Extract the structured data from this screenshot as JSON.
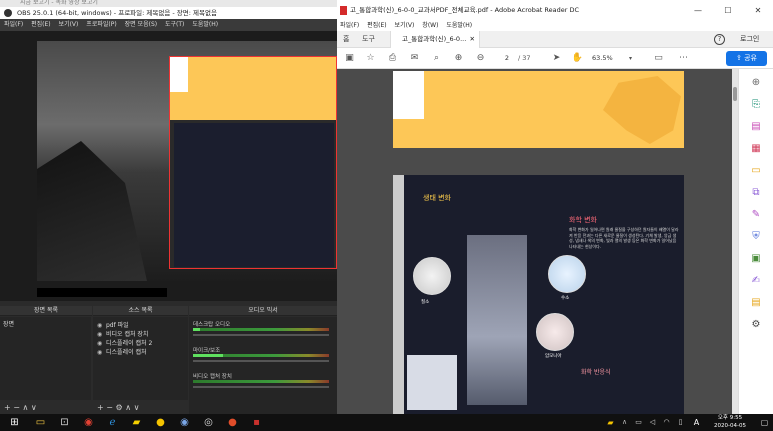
{
  "obs": {
    "ghost_title": "지금 보고기 - 녹화 영상 보고기",
    "title": "OBS 25.0.1 (64-bit, windows) - 프로파일: 제목없음 - 장면: 제목없음",
    "menu": [
      "파일(F)",
      "편집(E)",
      "보기(V)",
      "프로파일(P)",
      "장면 모음(S)",
      "도구(T)",
      "도움말(H)"
    ],
    "docks": {
      "scenes": {
        "title": "장면 목록",
        "items": [
          "장면"
        ],
        "footer": "+ − ∧ ∨"
      },
      "sources": {
        "title": "소스 목록",
        "items": [
          "pdf 파일",
          "비디오 캡처 장치",
          "디스플레이 캡처 2",
          "디스플레이 캡처"
        ],
        "footer": "+ − ⚙ ∧ ∨"
      },
      "mixer": {
        "title": "오디오 믹서",
        "channels": [
          {
            "name": "데스크탑 오디오",
            "level": 0.05
          },
          {
            "name": "마이크/보조",
            "level": 0.22
          },
          {
            "name": "비디오 캡처 장치",
            "level": 0.0
          }
        ]
      }
    }
  },
  "acrobat": {
    "title": "고_통합과학(신)_6-0-0_교과서PDF_전체교육.pdf - Adobe Acrobat Reader DC",
    "menu": [
      "파일(F)",
      "편집(E)",
      "보기(V)",
      "창(W)",
      "도움말(H)"
    ],
    "tabs": {
      "home": "홈",
      "tools": "도구",
      "doc": "고_통합과학(신)_6-0..."
    },
    "login": "로그인",
    "page_current": "2",
    "page_total": "/ 37",
    "zoom": "63.5%",
    "share": "공유",
    "pdf": {
      "section_title": "화학 변화",
      "banner": "생태 변화",
      "sub_heading": "화학 반응식",
      "body": "화학 변화가 일어나면 원래 물질을 구성하던 원자들이 배열이 달라져 반응 전과는 다른 새로운 물질이 생성된다. 기체 발생, 앙금 생성, 냄새나 색의 변화, 빛과 열의 발생 등은 화학 변화가 일어났음 나타내는 현상이다.",
      "labels": [
        "질소",
        "수소",
        "암모니아"
      ]
    }
  },
  "taskbar": {
    "time": "오후 9:55",
    "date": "2020-04-05",
    "ime": "A"
  },
  "colors": {
    "accent_blue": "#1473e6",
    "pdf_yellow": "#fdc757",
    "obs_bg": "#2b2b2b"
  }
}
